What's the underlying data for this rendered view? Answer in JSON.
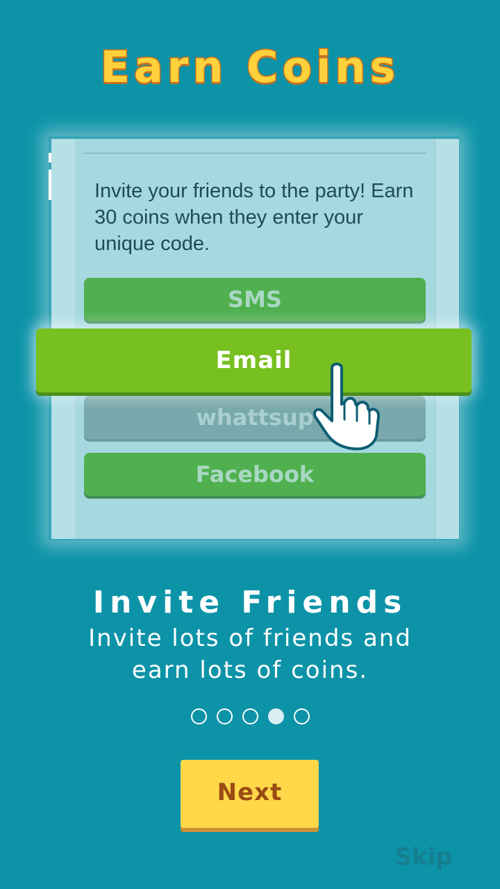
{
  "header": {
    "title": "Earn Coins"
  },
  "invite_card": {
    "message": "Invite your friends to the party! Earn 30 coins when they enter your unique code.",
    "buttons": {
      "sms": "SMS",
      "email": "Email",
      "whatsapp": "whattsup",
      "facebook": "Facebook"
    }
  },
  "slide": {
    "heading": "Invite Friends",
    "subtitle": "Invite lots of friends and earn lots of coins."
  },
  "pager": {
    "total": 5,
    "active_index": 4
  },
  "actions": {
    "next_label": "Next",
    "skip_label": "Skip"
  },
  "icons": {
    "pointer": "hand-pointer-icon"
  },
  "colors": {
    "background": "#0d93a8",
    "title": "#ffd23c",
    "email_button": "#77c01f",
    "share_button": "#50b04f",
    "next_button": "#ffd84a"
  }
}
